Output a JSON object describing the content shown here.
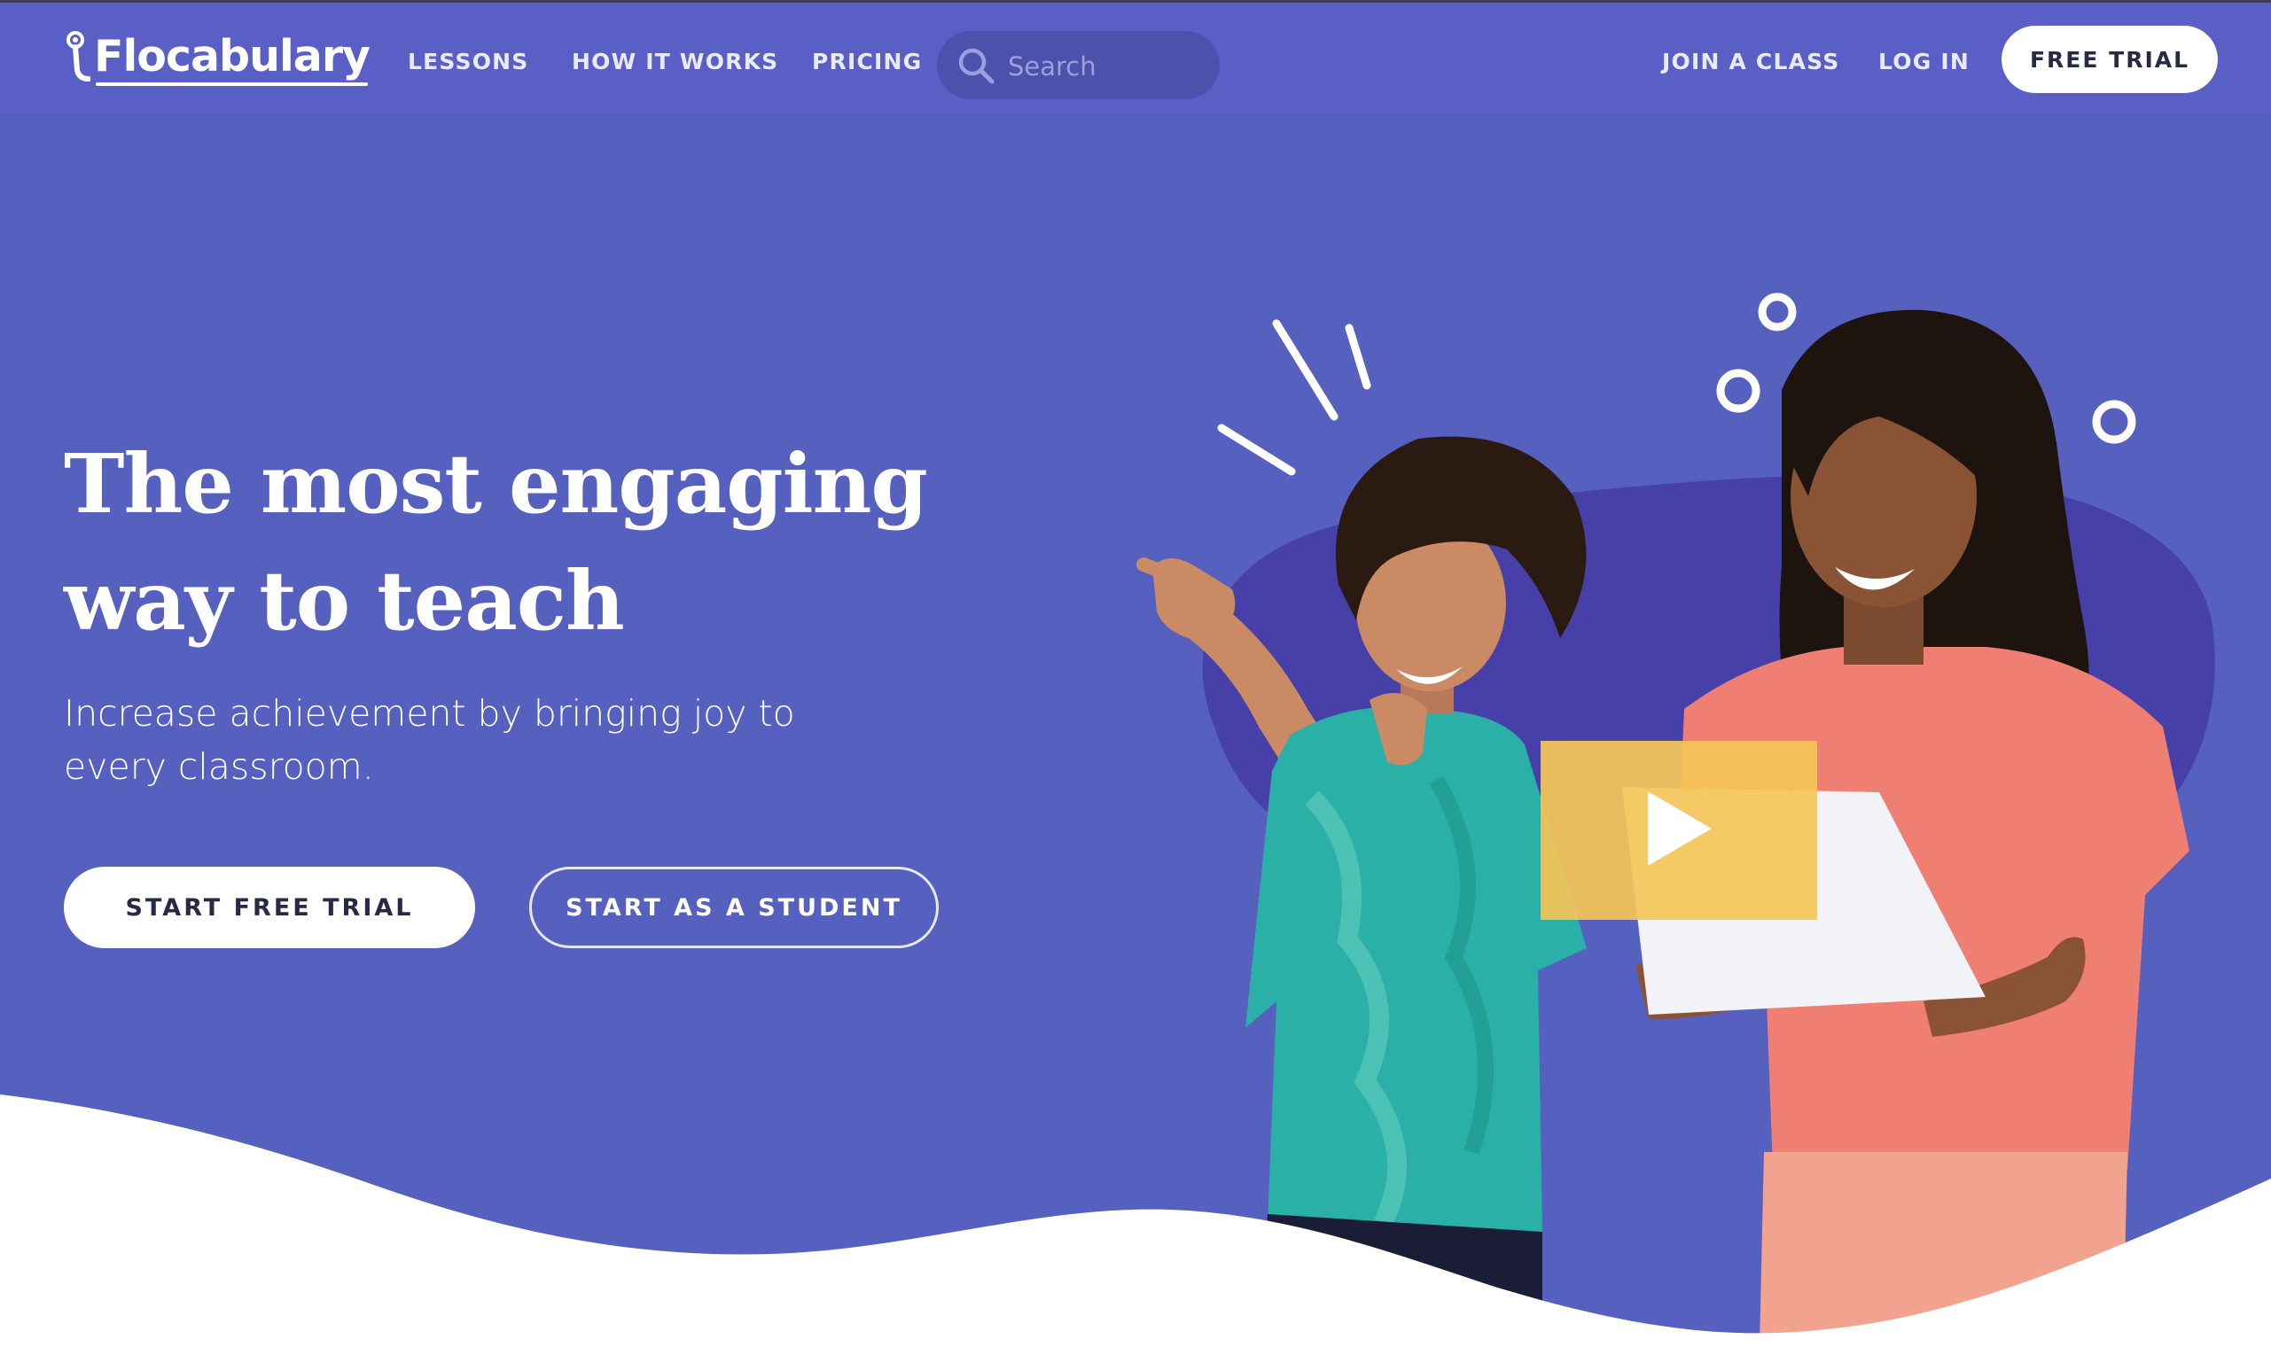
{
  "nav": {
    "logo_text": "Flocabulary",
    "links": {
      "lessons": "LESSONS",
      "how_it_works": "HOW IT WORKS",
      "pricing": "PRICING",
      "join_class": "JOIN A CLASS",
      "log_in": "LOG IN"
    },
    "search_placeholder": "Search",
    "free_trial": "FREE TRIAL"
  },
  "hero": {
    "title_line1": "The most engaging",
    "title_line2": "way to teach",
    "subtitle_line1": "Increase achievement by bringing joy to",
    "subtitle_line2": "every classroom.",
    "primary_cta": "START FREE TRIAL",
    "secondary_cta": "START AS A STUDENT"
  },
  "colors": {
    "background": "#5560bf",
    "nav_background": "#5a5fc5",
    "blob": "#4640a8",
    "play_overlay": "#f5c658",
    "button_text": "#262a45"
  },
  "icons": {
    "search": "search-icon",
    "play": "play-icon",
    "logo": "microphone-logo-icon"
  }
}
